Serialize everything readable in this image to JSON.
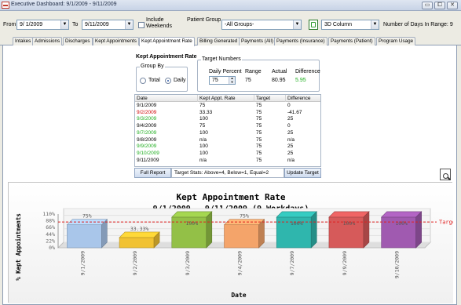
{
  "window": {
    "title": "Executive Dashboard: 9/1/2009 - 9/11/2009"
  },
  "toolbar": {
    "from_label": "From",
    "from_value": "9/ 1/2009",
    "to_label": "To",
    "to_value": "9/11/2009",
    "include_label": "Include",
    "weekends_label": "Weekends",
    "patient_group_label": "Patient Group",
    "patient_group_value": "-All Groups-",
    "column_value": "3D Column",
    "days_label": "Number of Days In Range: 9"
  },
  "tabs": [
    {
      "label": "Intakes"
    },
    {
      "label": "Admissions"
    },
    {
      "label": "Discharges"
    },
    {
      "label": "Kept Appointments"
    },
    {
      "label": "Kept Appointment Rate"
    },
    {
      "label": "Billing Generated"
    },
    {
      "label": "Payments (All)"
    },
    {
      "label": "Payments (Insurance)"
    },
    {
      "label": "Payments (Patient)"
    },
    {
      "label": "Program Usage"
    }
  ],
  "panel": {
    "title": "Kept Appointment Rate",
    "group_by": {
      "label": "Group By",
      "options": [
        {
          "label": "Total",
          "selected": false
        },
        {
          "label": "Daily",
          "selected": true
        }
      ]
    },
    "target_numbers": {
      "label": "Target Numbers",
      "daily_percent_label": "Daily Percent",
      "daily_percent_value": "75",
      "range_label": "Range",
      "range_value": "75",
      "actual_label": "Actual",
      "actual_value": "80.95",
      "difference_label": "Difference",
      "difference_value": "5.95"
    },
    "columns": [
      "Date",
      "Kept Appt. Rate",
      "Target",
      "Difference"
    ],
    "rows": [
      {
        "date": "9/1/2009",
        "rate": "75",
        "target": "75",
        "diff": "0",
        "color": "black"
      },
      {
        "date": "9/2/2009",
        "rate": "33.33",
        "target": "75",
        "diff": "-41.67",
        "color": "red"
      },
      {
        "date": "9/3/2009",
        "rate": "100",
        "target": "75",
        "diff": "25",
        "color": "green"
      },
      {
        "date": "9/4/2009",
        "rate": "75",
        "target": "75",
        "diff": "0",
        "color": "black"
      },
      {
        "date": "9/7/2009",
        "rate": "100",
        "target": "75",
        "diff": "25",
        "color": "green"
      },
      {
        "date": "9/8/2009",
        "rate": "n/a",
        "target": "75",
        "diff": "n/a",
        "color": "black"
      },
      {
        "date": "9/9/2009",
        "rate": "100",
        "target": "75",
        "diff": "25",
        "color": "green"
      },
      {
        "date": "9/10/2009",
        "rate": "100",
        "target": "75",
        "diff": "25",
        "color": "green"
      },
      {
        "date": "9/11/2009",
        "rate": "n/a",
        "target": "75",
        "diff": "n/a",
        "color": "black"
      }
    ],
    "full_report_label": "Full Report",
    "target_stats": "Target Stats: Above=4, Below=1, Equal=2",
    "update_target_label": "Update Target"
  },
  "chart_data": {
    "type": "bar",
    "title": "Kept Appointment Rate",
    "subtitle": "9/1/2009 - 9/11/2009 (9 Workdays)",
    "xlabel": "Date",
    "ylabel": "% Kept Appointments",
    "categories": [
      "9/1/2009",
      "9/2/2009",
      "9/3/2009",
      "9/4/2009",
      "9/7/2009",
      "9/9/2009",
      "9/10/2009"
    ],
    "values": [
      75,
      33.33,
      100,
      75,
      100,
      100,
      100
    ],
    "data_labels": [
      "75%",
      "33.33%",
      "100%",
      "75%",
      "100%",
      "100%",
      "100%"
    ],
    "colors": [
      "#a9c6ea",
      "#f1c232",
      "#93c047",
      "#f4a46a",
      "#2fb6ad",
      "#d65a5a",
      "#a05ab0"
    ],
    "y_ticks": [
      "110%",
      "88%",
      "66%",
      "44%",
      "22%",
      "0%"
    ],
    "ylim": [
      0,
      110
    ],
    "target": {
      "value": 75,
      "label": "Target",
      "color": "#e02020"
    },
    "grid": true
  }
}
